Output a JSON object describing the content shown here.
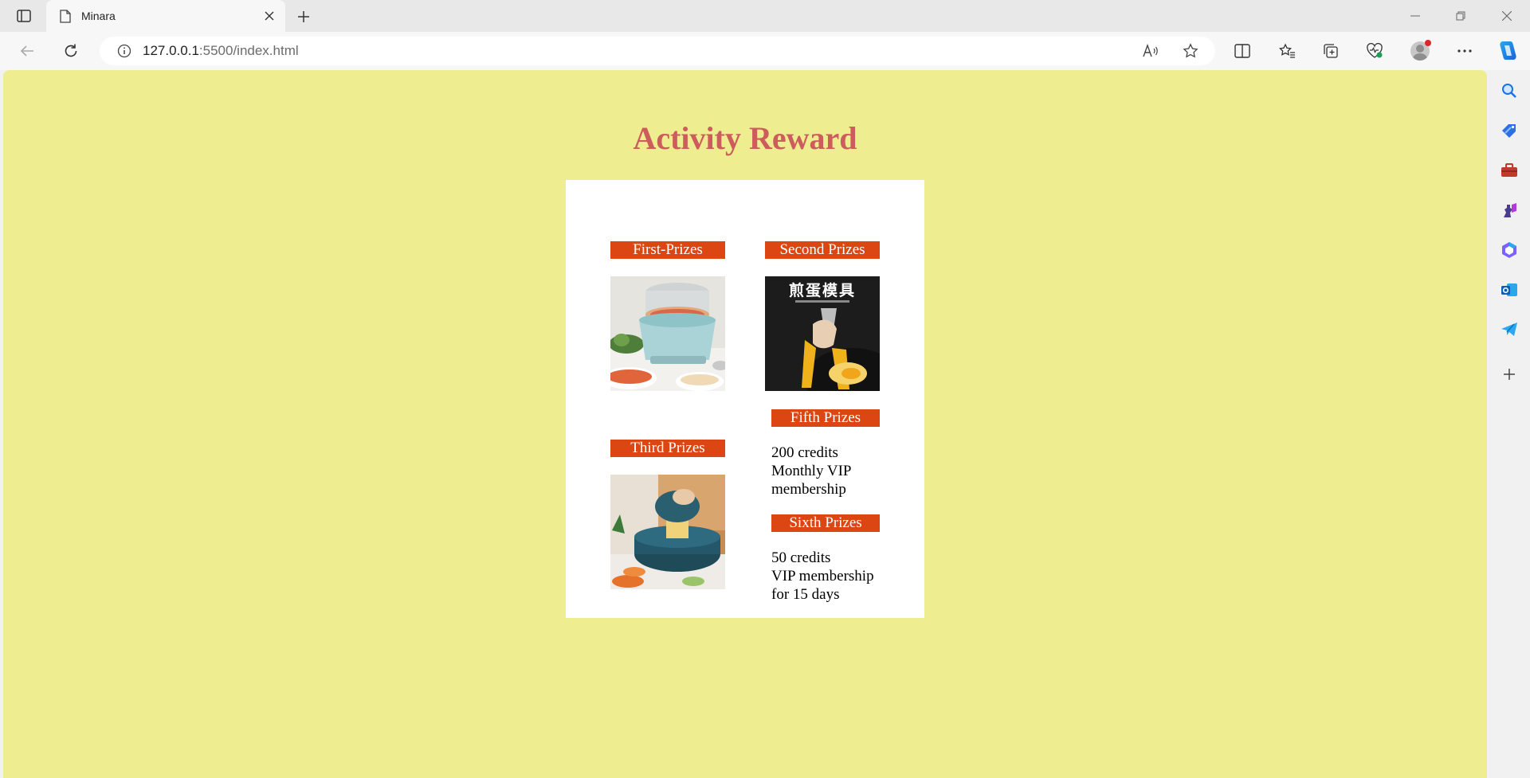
{
  "browser": {
    "tab_title": "Minara",
    "url_host": "127.0.0.1",
    "url_path": ":5500/index.html"
  },
  "page": {
    "title": "Activity Reward",
    "background_color": "#eeee91",
    "title_color": "#cd5c5c",
    "label_color": "#dc4612",
    "prizes": {
      "first": {
        "label": "First-Prizes"
      },
      "second": {
        "label": "Second Prizes",
        "image_text": "煎蛋模具"
      },
      "third": {
        "label": "Third Prizes"
      },
      "fifth": {
        "label": "Fifth Prizes",
        "lines": [
          "200 credits",
          "Monthly VIP",
          "membership"
        ]
      },
      "sixth": {
        "label": "Sixth Prizes",
        "lines": [
          "50 credits",
          "VIP membership",
          "for 15 days"
        ]
      }
    }
  },
  "icons": {
    "toolbar": [
      "back-icon",
      "refresh-icon",
      "info-icon",
      "read-aloud-icon",
      "favorite-star-icon",
      "split-screen-icon",
      "favorites-icon",
      "collections-icon",
      "browser-essentials-icon",
      "profile-icon",
      "more-icon",
      "copilot-icon"
    ],
    "sidebar": [
      "search-icon",
      "shopping-tag-icon",
      "tools-icon",
      "games-icon",
      "microsoft365-icon",
      "outlook-icon",
      "telegram-icon",
      "add-icon"
    ]
  }
}
